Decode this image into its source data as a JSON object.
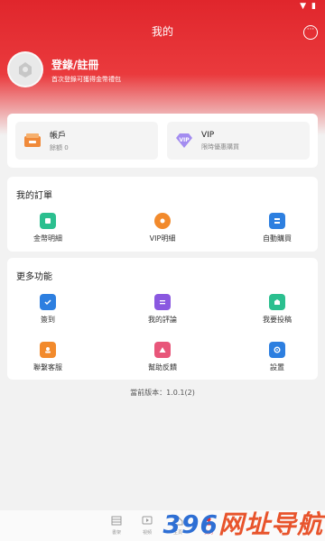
{
  "status_bar": {
    "time": ""
  },
  "header": {
    "title": "我的",
    "message_icon": "chat-bubble-icon"
  },
  "profile": {
    "login_title": "登錄/註冊",
    "login_subtitle": "首次登錄可獲得金幣禮包"
  },
  "quick_cards": [
    {
      "title": "帳戶",
      "subtitle": "餘額 0",
      "icon": "wallet-icon",
      "color": "#f08a3a"
    },
    {
      "title": "VIP",
      "subtitle": "限時優惠購買",
      "icon": "vip-diamond-icon",
      "color": "#a38cf0"
    }
  ],
  "orders": {
    "title": "我的訂單",
    "items": [
      {
        "label": "金幣明細",
        "icon": "coin-detail-icon",
        "color": "#2bbf8f"
      },
      {
        "label": "VIP明細",
        "icon": "vip-bag-icon",
        "color": "#f28a2c"
      },
      {
        "label": "自動購買",
        "icon": "auto-buy-icon",
        "color": "#2d7fe0"
      }
    ]
  },
  "more": {
    "title": "更多功能",
    "items": [
      {
        "label": "簽到",
        "icon": "checkin-icon",
        "color": "#2d7fe0"
      },
      {
        "label": "我的評論",
        "icon": "comment-icon",
        "color": "#8a58e0"
      },
      {
        "label": "我要投稿",
        "icon": "submit-icon",
        "color": "#2bbf8f"
      },
      {
        "label": "聯繫客服",
        "icon": "customer-service-icon",
        "color": "#f28a2c"
      },
      {
        "label": "幫助反饋",
        "icon": "feedback-icon",
        "color": "#e8567a"
      },
      {
        "label": "設置",
        "icon": "settings-icon",
        "color": "#2d7fe0"
      }
    ]
  },
  "version": "當前版本：1.0.1(2)",
  "tab_bar": [
    {
      "label": "書架",
      "icon": "bookshelf-icon"
    },
    {
      "label": "視頻",
      "icon": "video-icon"
    },
    {
      "label": "主頁",
      "icon": "home-icon"
    },
    {
      "label": "我的",
      "icon": "profile-icon",
      "active": true
    }
  ],
  "watermark": {
    "text_main": "396",
    "text_accent": "网址导航"
  },
  "colors": {
    "brand_red": "#e0262c",
    "background": "#f2f2f2"
  }
}
